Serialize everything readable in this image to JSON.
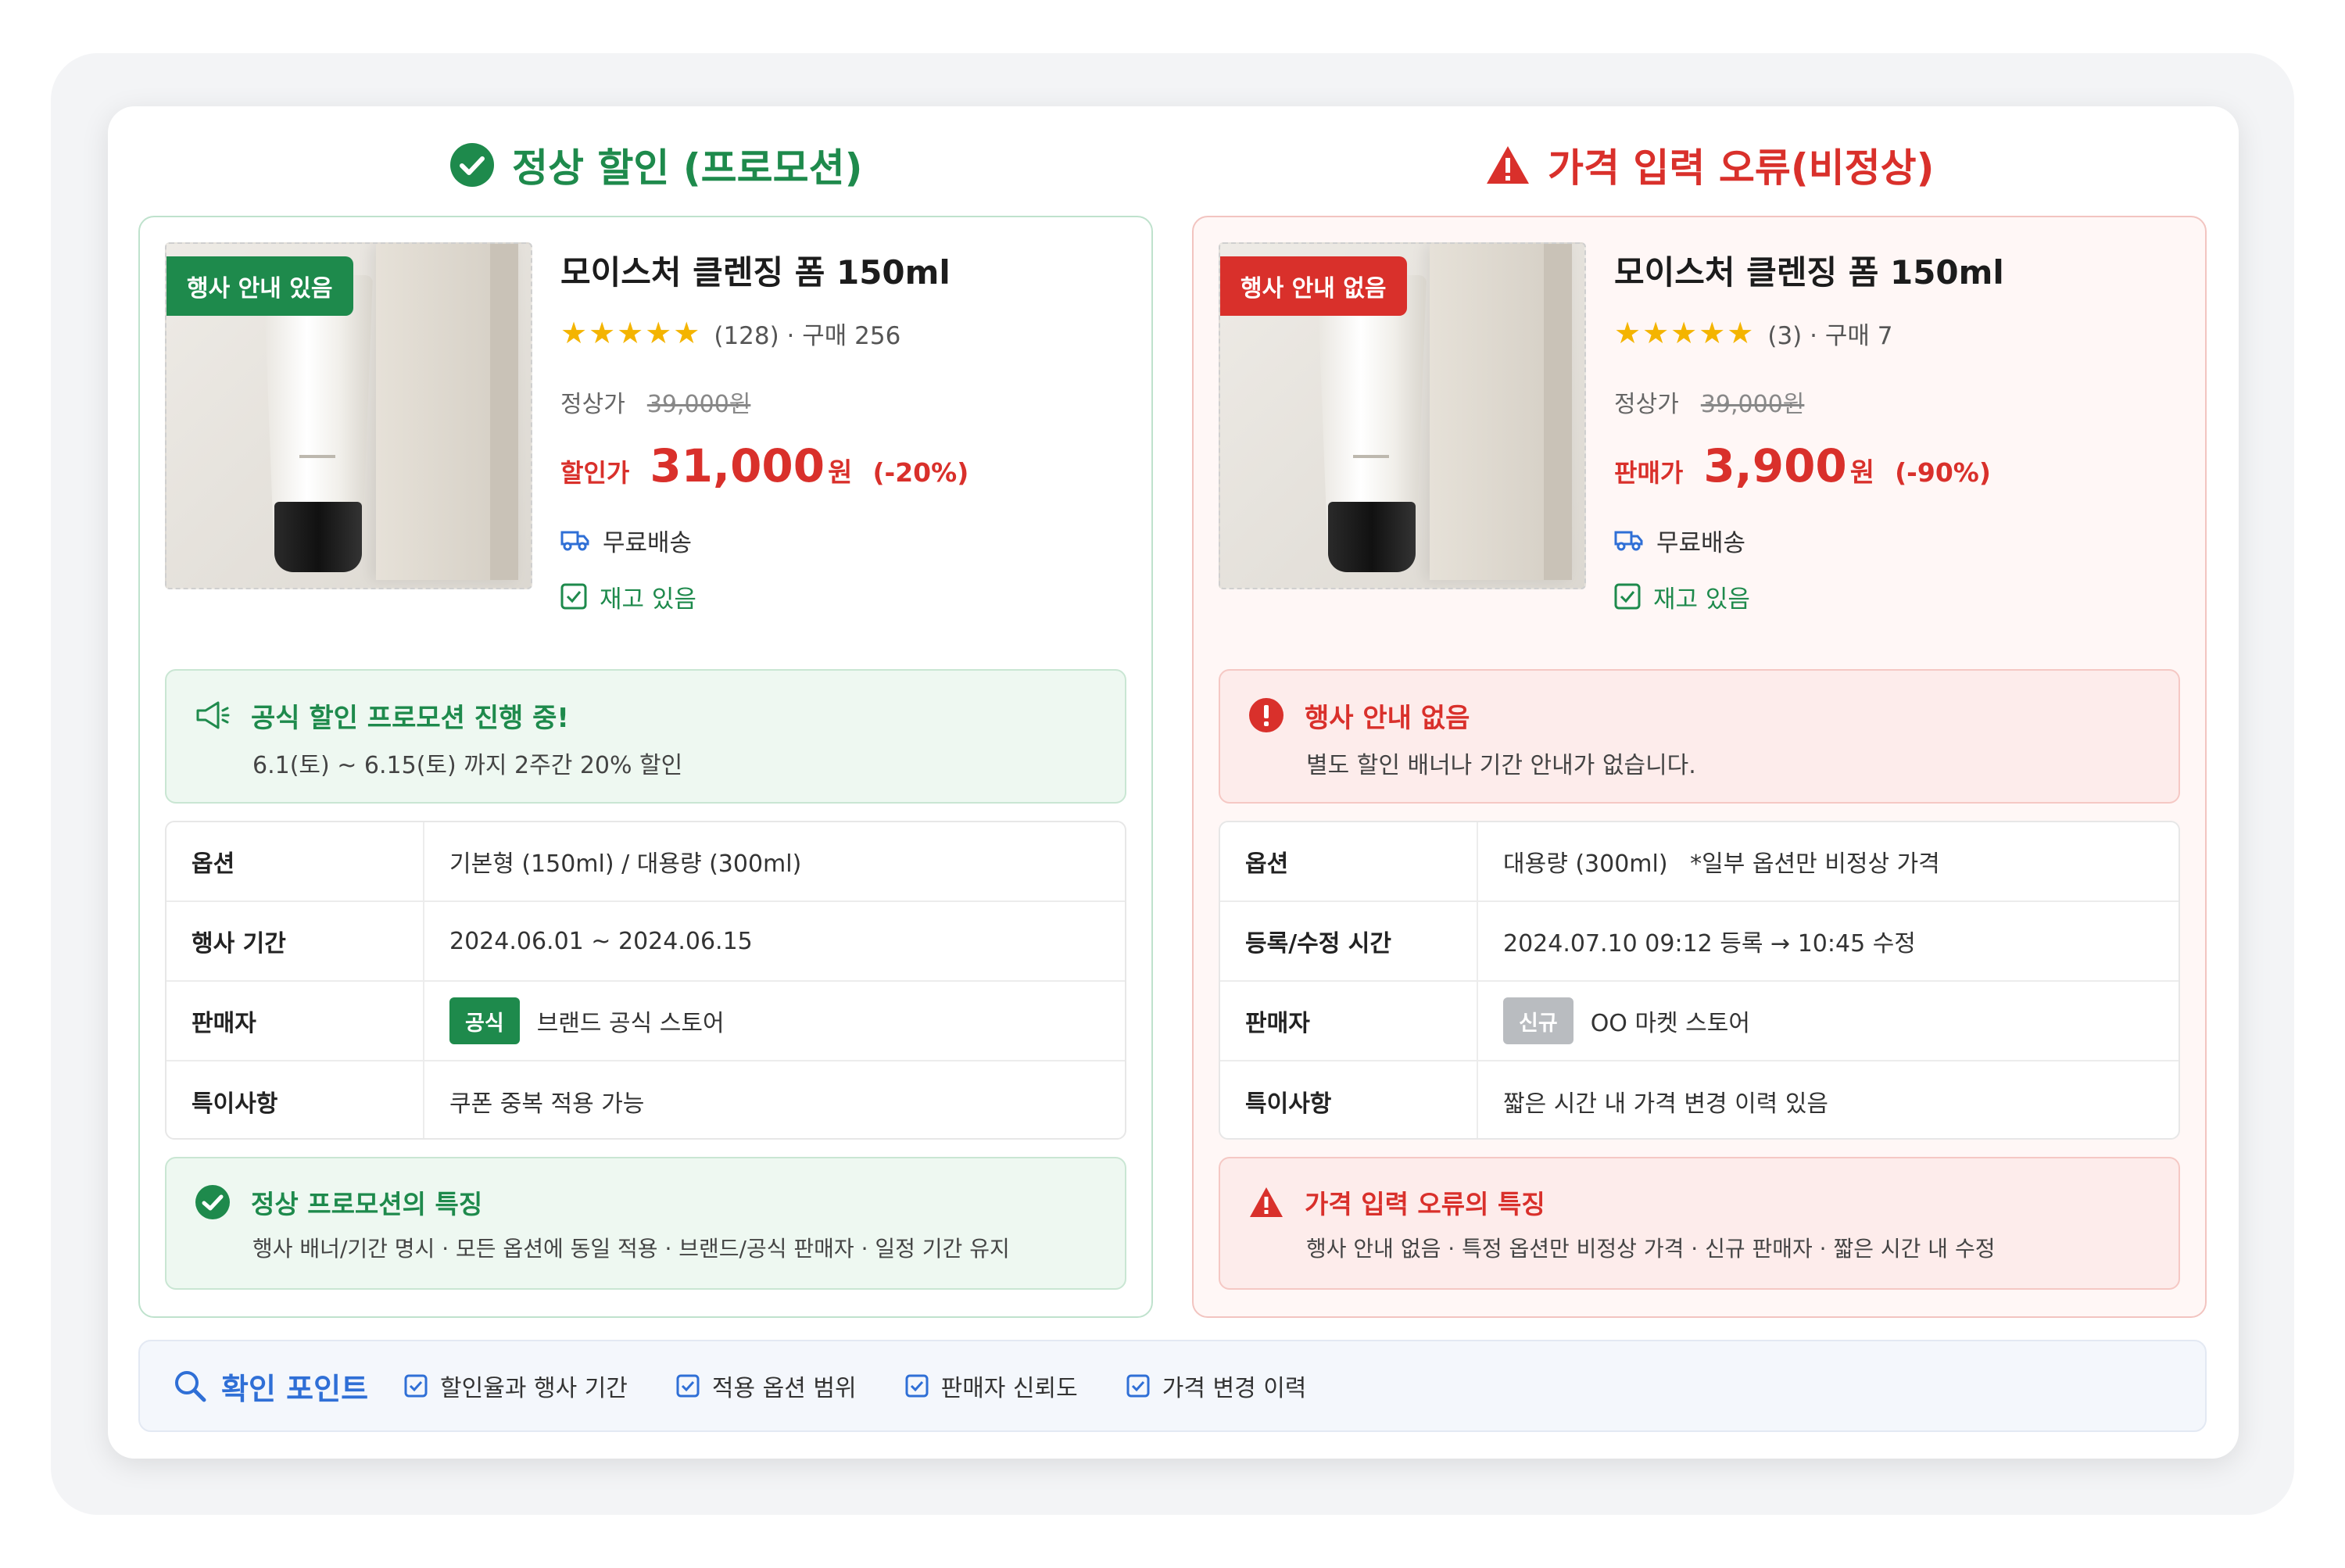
{
  "normal": {
    "heading": "정상 할인 (프로모션)",
    "badge": "행사 안내 있음",
    "product_name": "모이스처 클렌징 폼 150ml",
    "stars": "★★★★★",
    "rating_meta": "(128) · 구매 256",
    "regular_label": "정상가",
    "regular_price": "39,000원",
    "sale_label": "할인가",
    "sale_price": "31,000",
    "sale_unit": "원",
    "discount": "(-20%)",
    "shipping": "무료배송",
    "stock": "재고 있음",
    "notice_title": "공식 할인 프로모션 진행 중!",
    "notice_body": "6.1(토) ~ 6.15(토) 까지 2주간 20% 할인",
    "table": [
      {
        "key": "옵션",
        "value": "기본형 (150ml) / 대용량 (300ml)"
      },
      {
        "key": "행사 기간",
        "value": "2024.06.01 ~ 2024.06.15"
      },
      {
        "key": "판매자",
        "tag": "공식",
        "value": "브랜드 공식 스토어"
      },
      {
        "key": "특이사항",
        "value": "쿠폰 중복 적용 가능"
      }
    ],
    "summary_title": "정상 프로모션의 특징",
    "summary_body": "행사 배너/기간 명시 · 모든 옵션에 동일 적용 · 브랜드/공식 판매자 · 일정 기간 유지"
  },
  "error": {
    "heading": "가격 입력 오류(비정상)",
    "badge": "행사 안내 없음",
    "product_name": "모이스처 클렌징 폼 150ml",
    "stars": "★★★★★",
    "rating_meta": "(3) · 구매 7",
    "regular_label": "정상가",
    "regular_price": "39,000원",
    "sale_label": "판매가",
    "sale_price": "3,900",
    "sale_unit": "원",
    "discount": "(-90%)",
    "shipping": "무료배송",
    "stock": "재고 있음",
    "notice_title": "행사 안내 없음",
    "notice_body": "별도 할인 배너나 기간 안내가 없습니다.",
    "table": [
      {
        "key": "옵션",
        "value": "대용량 (300ml)   *일부 옵션만 비정상 가격"
      },
      {
        "key": "등록/수정 시간",
        "value": "2024.07.10 09:12 등록 → 10:45 수정"
      },
      {
        "key": "판매자",
        "tag": "신규",
        "value": "OO 마켓 스토어"
      },
      {
        "key": "특이사항",
        "value": "짧은 시간 내 가격 변경 이력 있음"
      }
    ],
    "summary_title": "가격 입력 오류의 특징",
    "summary_body": "행사 안내 없음 · 특정 옵션만 비정상 가격 · 신규 판매자 · 짧은 시간 내 수정"
  },
  "checkpoints": {
    "title": "확인 포인트",
    "items": [
      "할인율과 행사 기간",
      "적용 옵션 범위",
      "판매자 신뢰도",
      "가격 변경 이력"
    ]
  },
  "colors": {
    "ok": "#1e8a4c",
    "error": "#d9302b",
    "accent": "#2f6fd6"
  }
}
